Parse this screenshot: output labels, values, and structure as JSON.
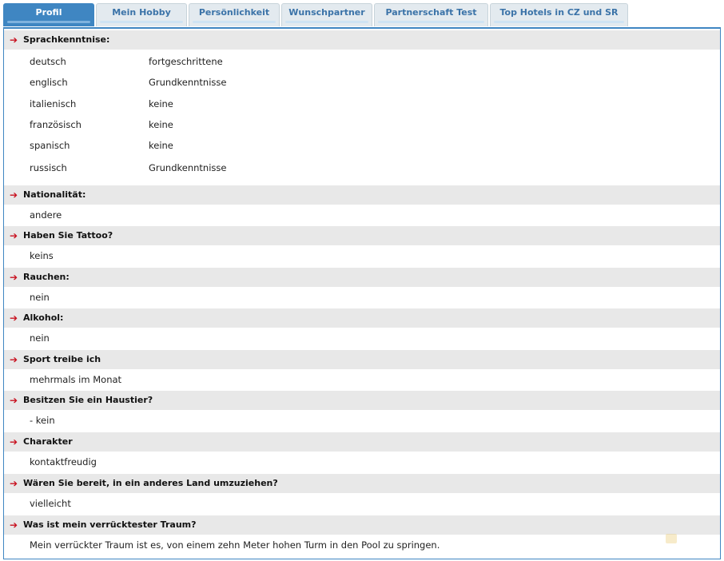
{
  "tabs": [
    {
      "label": "Profil",
      "active": true
    },
    {
      "label": "Mein Hobby",
      "active": false
    },
    {
      "label": "Persönlichkeit",
      "active": false
    },
    {
      "label": "Wunschpartner",
      "active": false
    },
    {
      "label": "Partnerschaft Test",
      "active": false
    },
    {
      "label": "Top Hotels in CZ und SR",
      "active": false
    }
  ],
  "arrow_icon": "➔",
  "arrow_color": "#c8101e",
  "accent": "#3f86c2",
  "sprachen": {
    "title": "Sprachkenntnise:",
    "items": [
      {
        "name": "deutsch",
        "level": "fortgeschrittene"
      },
      {
        "name": "englisch",
        "level": "Grundkenntnisse"
      },
      {
        "name": "italienisch",
        "level": "keine"
      },
      {
        "name": "französisch",
        "level": "keine"
      },
      {
        "name": "spanisch",
        "level": "keine"
      },
      {
        "name": "russisch",
        "level": "Grundkenntnisse"
      }
    ]
  },
  "sections": [
    {
      "question": "Nationalität:",
      "answer": "andere"
    },
    {
      "question": "Haben Sie Tattoo?",
      "answer": "keins"
    },
    {
      "question": "Rauchen:",
      "answer": "nein"
    },
    {
      "question": "Alkohol:",
      "answer": "nein"
    },
    {
      "question": "Sport treibe ich",
      "answer": "mehrmals im Monat"
    },
    {
      "question": "Besitzen Sie ein Haustier?",
      "answer": "- kein"
    },
    {
      "question": "Charakter",
      "answer": "kontaktfreudig"
    },
    {
      "question": "Wären Sie bereit, in ein anderes Land umzuziehen?",
      "answer": "vielleicht"
    },
    {
      "question": "Was ist mein verrücktester Traum?",
      "answer": "Mein verrückter Traum ist es, von einem zehn Meter hohen Turm in den Pool zu springen."
    }
  ]
}
